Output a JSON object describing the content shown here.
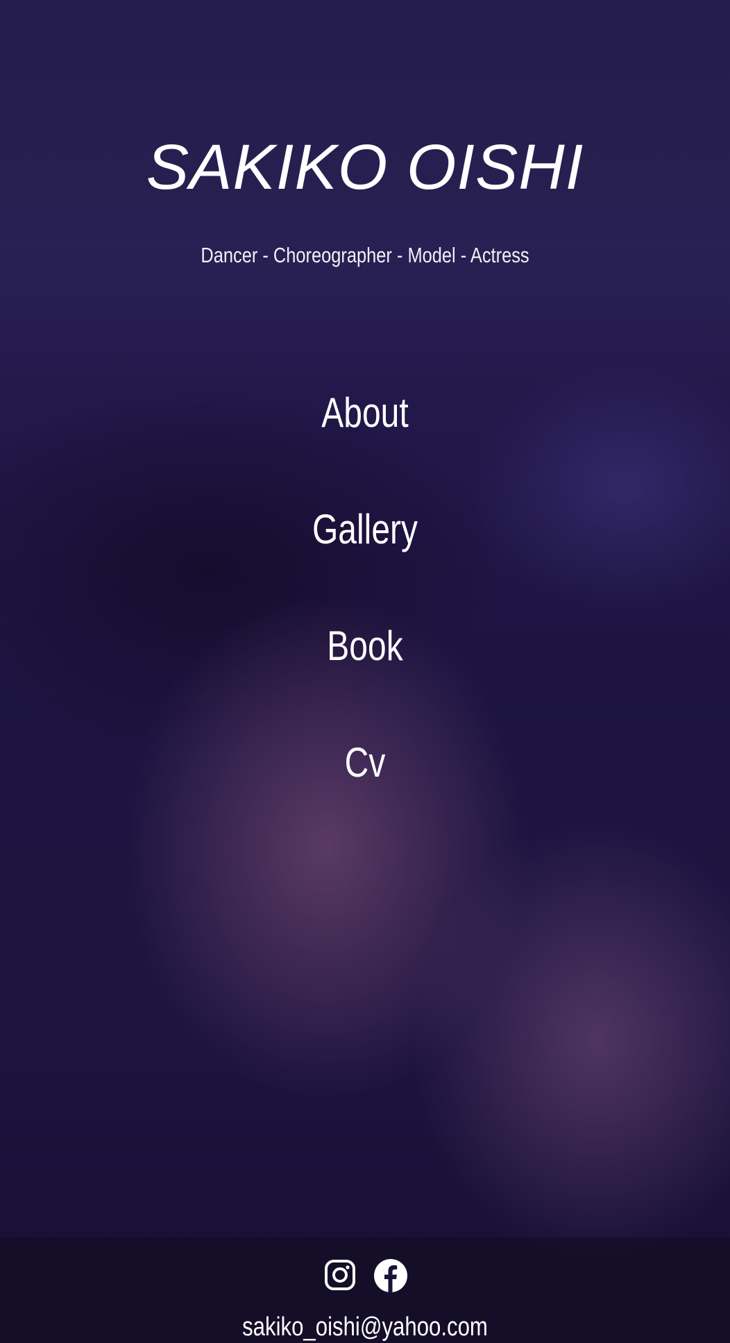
{
  "header": {
    "title": "SAKIKO OISHI",
    "tagline": "Dancer - Choreographer - Model - Actress"
  },
  "nav": {
    "items": [
      {
        "label": "About"
      },
      {
        "label": "Gallery"
      },
      {
        "label": "Book"
      },
      {
        "label": "Cv"
      }
    ]
  },
  "footer": {
    "social": [
      {
        "icon": "instagram-icon"
      },
      {
        "icon": "facebook-icon"
      }
    ],
    "email": "sakiko_oishi@yahoo.com"
  },
  "colors": {
    "background": "#1a1238",
    "text": "#ffffff",
    "footer": "#140e24"
  }
}
